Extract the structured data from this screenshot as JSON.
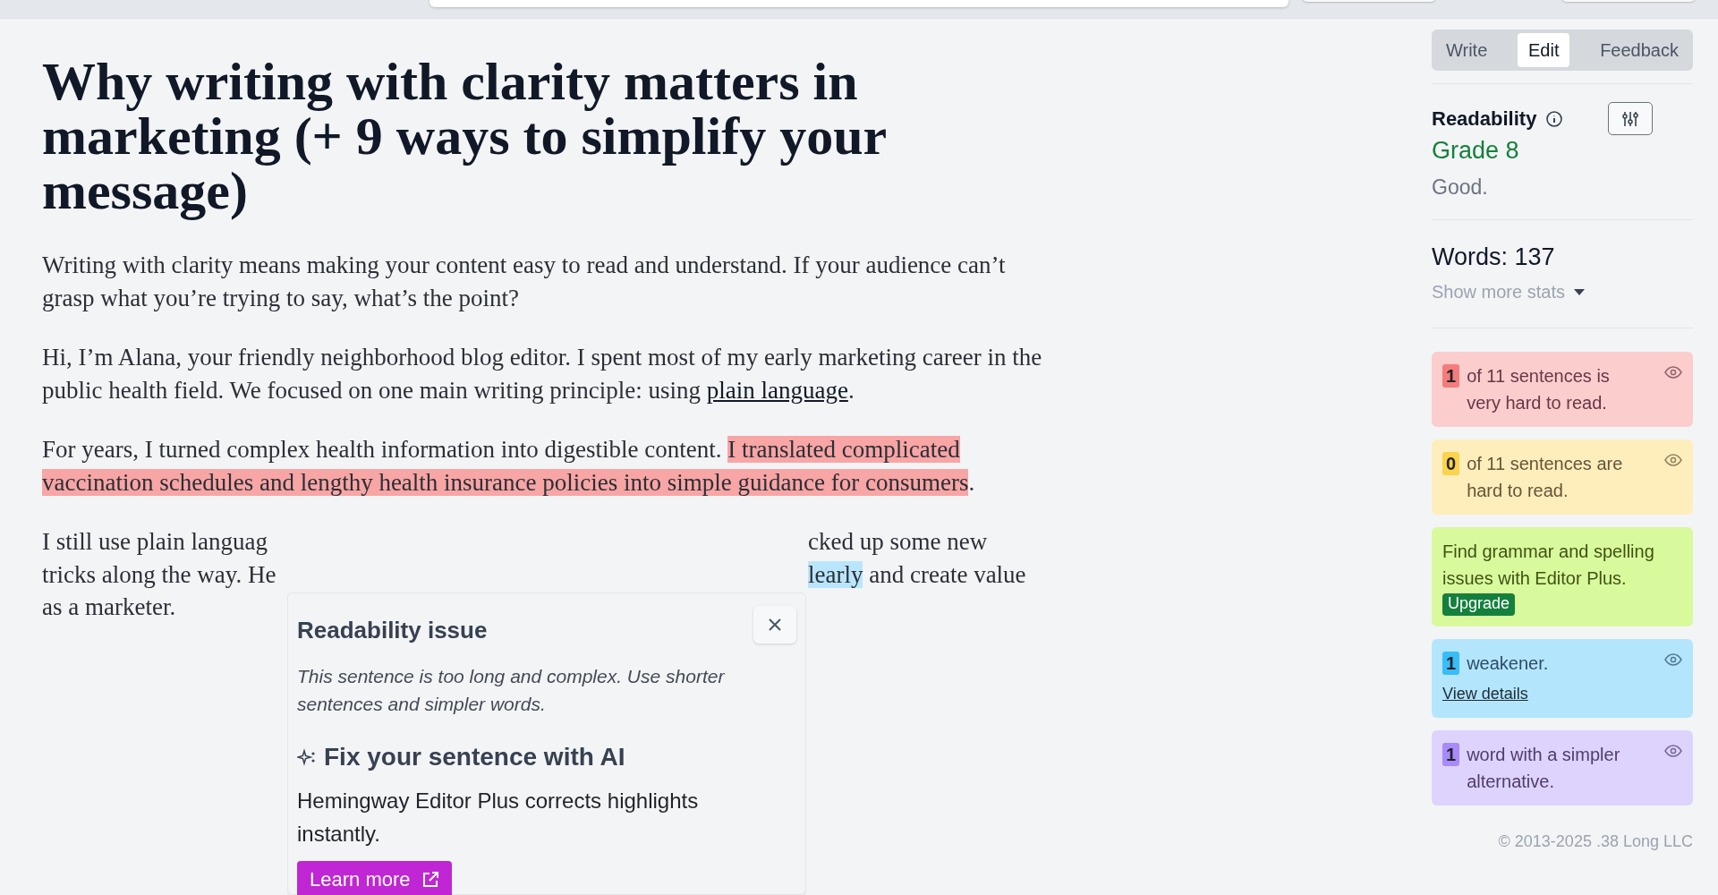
{
  "article": {
    "title": "Why writing with clarity matters in marketing (+ 9 ways to simplify your message)",
    "paragraphs": [
      {
        "segments": [
          {
            "kind": "plain",
            "text": "Writing with clarity means making your content easy to read and understand. If your audience can’t grasp what you’re trying to say, what’s the point?"
          }
        ]
      },
      {
        "segments": [
          {
            "kind": "plain",
            "text": "Hi, I’m Alana, your friendly neighborhood blog editor. I spent most of my early marketing career in the public health field. We focused on one main writing principle: using "
          },
          {
            "kind": "link",
            "text": "plain language"
          },
          {
            "kind": "plain",
            "text": "."
          }
        ]
      },
      {
        "segments": [
          {
            "kind": "plain",
            "text": "For years, I turned complex health information into digestible content. "
          },
          {
            "kind": "very_hard",
            "text": "I translated complicated vaccination schedules and lengthy health insurance policies into simple guidance for consumers"
          },
          {
            "kind": "plain",
            "text": "."
          }
        ]
      }
    ],
    "covered_paragraph": [
      {
        "left": [
          {
            "kind": "plain",
            "text": "I still use plain languag"
          }
        ],
        "right": [
          {
            "kind": "plain",
            "text": "cked up some new"
          }
        ]
      },
      {
        "left": [
          {
            "kind": "plain",
            "text": "tricks along the way. He"
          }
        ],
        "right": [
          {
            "kind": "weakener",
            "text": "learly"
          },
          {
            "kind": "plain",
            "text": " and create value"
          }
        ]
      },
      {
        "left": [
          {
            "kind": "plain",
            "text": "as a marketer."
          }
        ]
      }
    ]
  },
  "popup": {
    "title": "Readability issue",
    "description": "This sentence is too long and complex. Use shorter sentences and simpler words.",
    "ai_heading": "Fix your sentence with AI",
    "ai_text": "Hemingway Editor Plus corrects highlights instantly.",
    "button": "Learn more"
  },
  "mode_tabs": [
    {
      "label": "Write",
      "selected": false
    },
    {
      "label": "Edit",
      "selected": true
    },
    {
      "label": "Feedback",
      "selected": false
    }
  ],
  "readability": {
    "title": "Readability",
    "grade": "Grade 8",
    "verdict": "Good."
  },
  "stats": {
    "words": "Words: 137",
    "more": "Show more stats"
  },
  "cards": [
    {
      "kind": "count",
      "color": "#f47c7c",
      "count": "1",
      "text": "of 11 sentences is very hard to read."
    },
    {
      "kind": "count",
      "color": "#fcd34d",
      "count": "0",
      "text": "of 11 sentences are hard to read."
    },
    {
      "kind": "promo",
      "color": "#d9f99d",
      "text": "Find grammar and spelling issues with Editor Plus.",
      "button": "Upgrade"
    },
    {
      "kind": "count",
      "color": "#38bdf8",
      "count": "1",
      "text": "weakener.",
      "link": "View details"
    },
    {
      "kind": "count",
      "color": "#a78bfa",
      "count": "1",
      "text": "word with a simpler alternative."
    }
  ],
  "footer": "© 2013-2025 .38 Long LLC"
}
